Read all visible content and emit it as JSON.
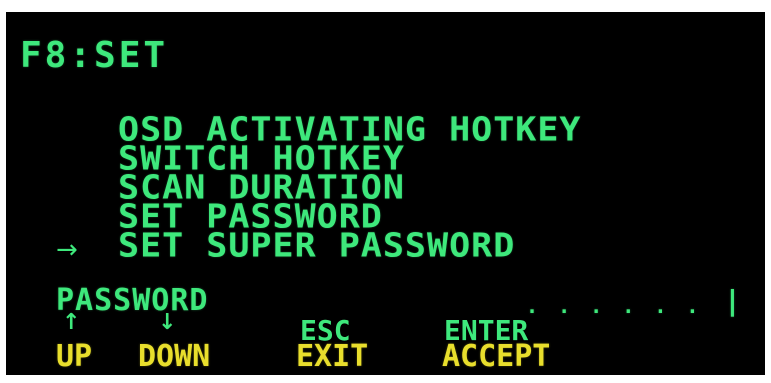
{
  "screen": {
    "title": "F8:SET"
  },
  "menu": {
    "items": [
      {
        "label": "OSD ACTIVATING HOTKEY"
      },
      {
        "label": "SWITCH HOTKEY"
      },
      {
        "label": "SCAN DURATION"
      },
      {
        "label": "SET PASSWORD"
      },
      {
        "label": "SET SUPER PASSWORD"
      }
    ],
    "selected_index": 4,
    "cursor_glyph": "→"
  },
  "password": {
    "label": "PASSWORD",
    "value_mask": ". . . . . .",
    "caret": "|"
  },
  "keys": {
    "up": {
      "key": "↑",
      "action": "UP"
    },
    "down": {
      "key": "↓",
      "action": "DOWN"
    },
    "esc": {
      "key": "ESC",
      "action": "EXIT"
    },
    "enter": {
      "key": "ENTER",
      "action": "ACCEPT"
    }
  },
  "colors": {
    "background": "#000000",
    "text_green": "#3ee87c",
    "text_yellow": "#e8de2c"
  }
}
